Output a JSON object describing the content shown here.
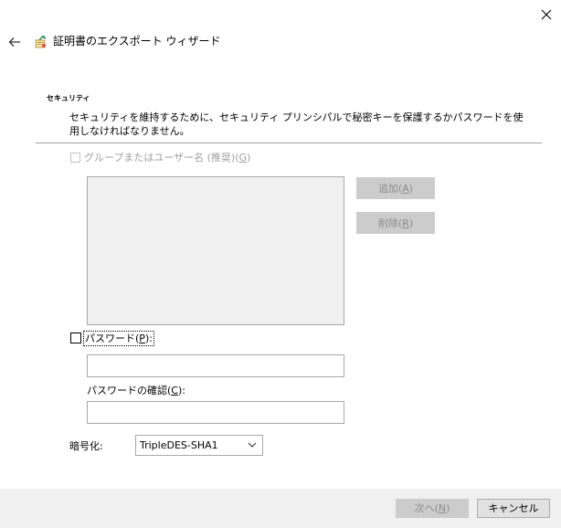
{
  "window": {
    "close_icon": "close-icon"
  },
  "header": {
    "back_icon": "back-arrow-icon",
    "wizard_icon": "certificate-icon",
    "title": "証明書のエクスポート ウィザード"
  },
  "section": {
    "title": "セキュリティ",
    "description": "セキュリティを維持するために、セキュリティ プリンシパルで秘密キーを保護するかパスワードを使用しなければなりません。"
  },
  "group_option": {
    "label": "グループまたはユーザー名 (推奨)(",
    "mnemonic": "G",
    "label_end": ")",
    "checked": false,
    "enabled": false
  },
  "buttons": {
    "add_label": "追加(",
    "add_mnemonic": "A",
    "add_end": ")",
    "remove_label": "削除(",
    "remove_mnemonic": "R",
    "remove_end": ")",
    "next_label": "次へ(",
    "next_mnemonic": "N",
    "next_end": ")",
    "cancel_label": "キャンセル"
  },
  "password_option": {
    "label": "パスワード(",
    "mnemonic": "P",
    "label_end": "):",
    "checked": false,
    "value": ""
  },
  "confirm_password": {
    "label": "パスワードの確認(",
    "mnemonic": "C",
    "label_end": "):",
    "value": ""
  },
  "encryption": {
    "label": "暗号化:",
    "selected": "TripleDES-SHA1"
  },
  "colors": {
    "disabled_text": "#a0a0a0",
    "listbox_bg": "#f0f0f0",
    "footer_bg": "#f0f0f0",
    "button_disabled_bg": "#cccccc",
    "button_bg": "#e1e1e1"
  }
}
